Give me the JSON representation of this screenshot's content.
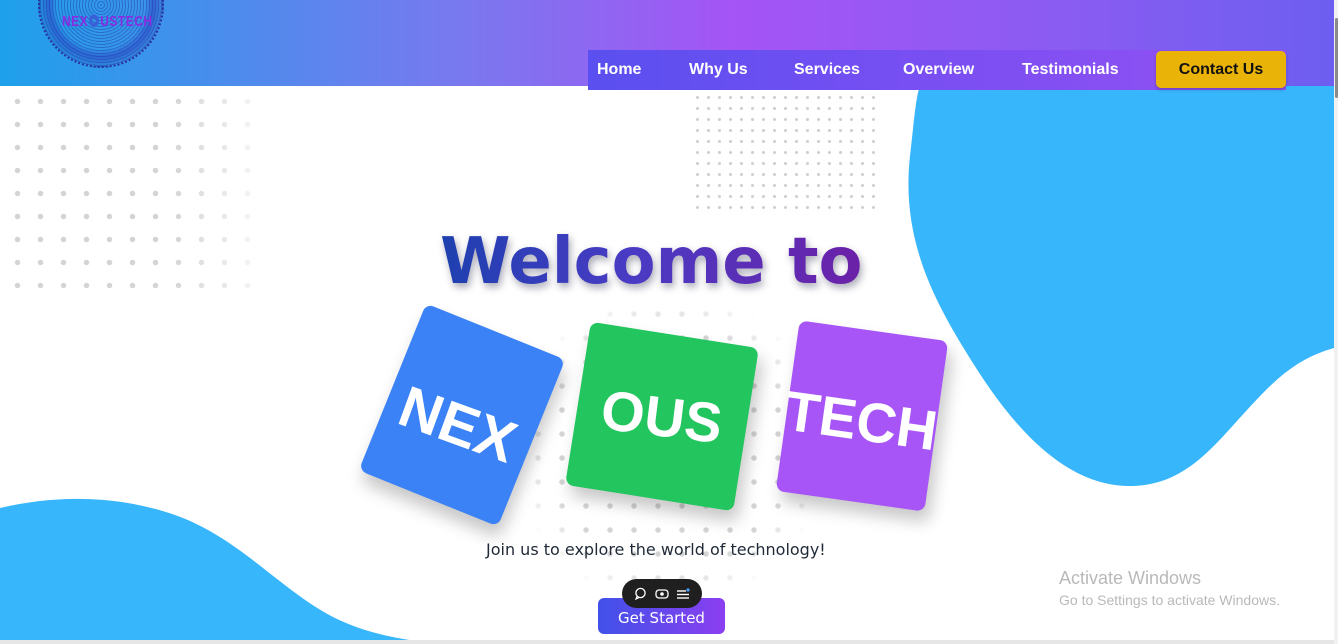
{
  "header": {
    "logo_text_left": "NEX",
    "logo_text_right": "USTECH",
    "nav": {
      "items": [
        "Home",
        "Why Us",
        "Services",
        "Overview",
        "Testimonials"
      ],
      "contact_label": "Contact Us"
    }
  },
  "hero": {
    "title": "Welcome to",
    "cards": [
      "NEX",
      "OUS",
      "TECH"
    ],
    "tagline": "Join us to explore the world of technology!",
    "cta_label": "Get Started"
  },
  "watermark": {
    "line1": "Activate Windows",
    "line2": "Go to Settings to activate Windows."
  },
  "floating_toolbar": {
    "icons": [
      "comment-icon",
      "eye-icon",
      "menu-list-icon"
    ]
  },
  "colors": {
    "header_gradient": [
      "#1ea0ea",
      "#a554f5",
      "#6d5ef0"
    ],
    "blob": "#38b6fc",
    "contact_button": "#eab308",
    "card_nex": "#3b82f6",
    "card_ous": "#22c55e",
    "card_tech": "#a855f7",
    "title_gradient": [
      "#1e40af",
      "#6b21a8"
    ]
  }
}
